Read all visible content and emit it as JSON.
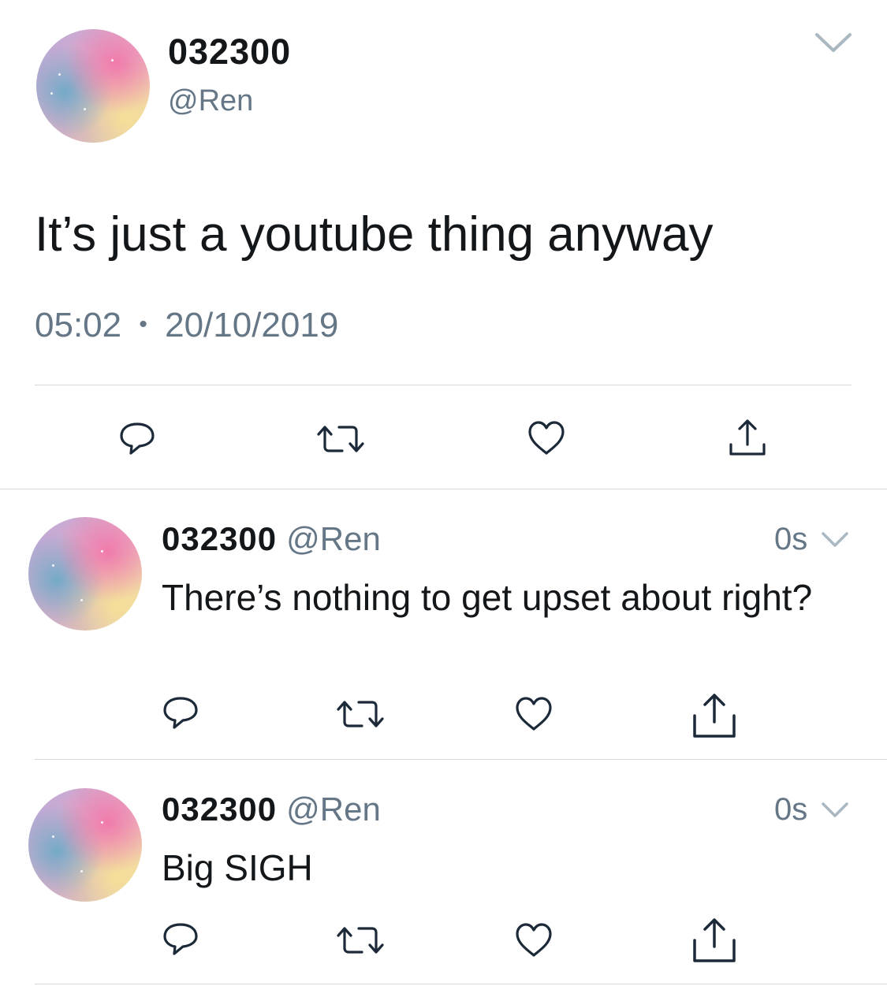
{
  "main_tweet": {
    "display_name": "032300",
    "handle": "@Ren",
    "text": "It’s just a youtube thing anyway",
    "time": "05:02",
    "dot": "•",
    "date": "20/10/2019",
    "icons": [
      "reply-icon",
      "retweet-icon",
      "like-icon",
      "share-icon"
    ]
  },
  "replies": [
    {
      "display_name": "032300",
      "handle": "@Ren",
      "relative_time": "0s",
      "text": "There’s nothing to get upset about right?"
    },
    {
      "display_name": "032300",
      "handle": "@Ren",
      "relative_time": "0s",
      "text": "Big SIGH"
    }
  ],
  "colors": {
    "text": "#14171a",
    "secondary": "#657786",
    "icon": "#1c2938",
    "divider": "#d3d7da"
  }
}
